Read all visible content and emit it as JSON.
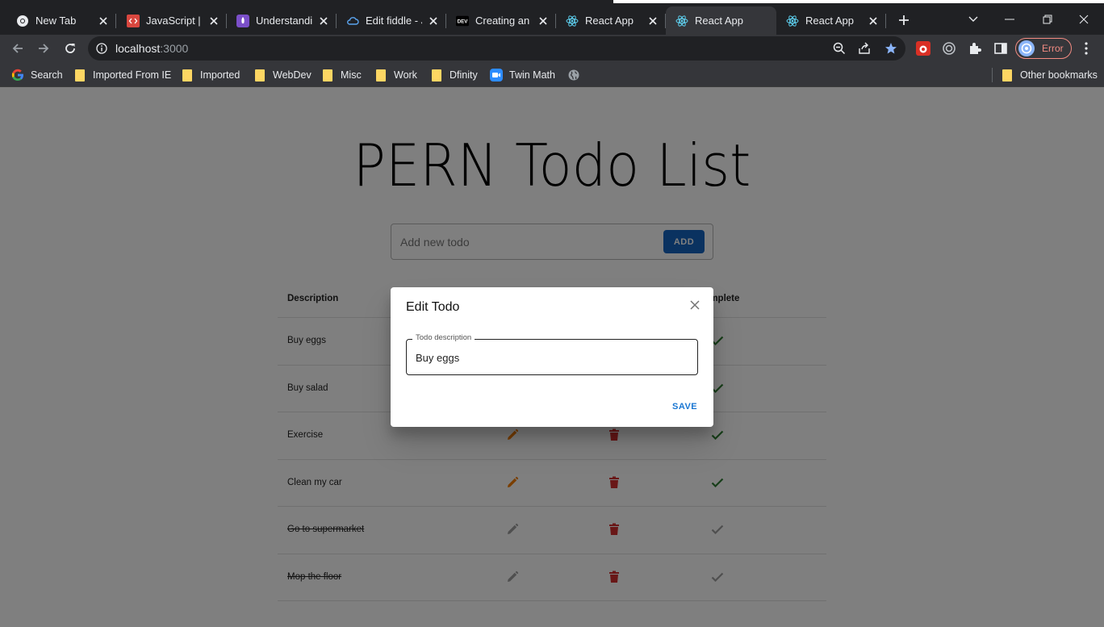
{
  "browser": {
    "tabs": [
      {
        "title": "New Tab",
        "icon": "chrome-icon",
        "active": false
      },
      {
        "title": "JavaScript | C",
        "icon": "code-icon",
        "active": false
      },
      {
        "title": "Understandin",
        "icon": "rocket-icon",
        "active": false
      },
      {
        "title": "Edit fiddle - JS",
        "icon": "cloud-icon",
        "active": false
      },
      {
        "title": "Creating an A",
        "icon": "dev-icon",
        "active": false
      },
      {
        "title": "React App",
        "icon": "react-icon",
        "active": false
      },
      {
        "title": "React App",
        "icon": "react-icon",
        "active": true
      },
      {
        "title": "React App",
        "icon": "react-icon",
        "active": false
      }
    ],
    "url_host": "localhost",
    "url_port": ":3000",
    "profile_label": "Error",
    "dev_badge": "DEV",
    "bookmarks": [
      {
        "label": "Search",
        "icon": "google-icon"
      },
      {
        "label": "Imported From IE",
        "icon": "folder-icon"
      },
      {
        "label": "Imported",
        "icon": "folder-icon"
      },
      {
        "label": "WebDev",
        "icon": "folder-icon"
      },
      {
        "label": "Misc",
        "icon": "folder-icon"
      },
      {
        "label": "Work",
        "icon": "folder-icon"
      },
      {
        "label": "Dfinity",
        "icon": "folder-icon"
      },
      {
        "label": "Twin Math",
        "icon": "zoom-icon"
      }
    ],
    "other_bookmarks": "Other bookmarks"
  },
  "app": {
    "title": "PERN Todo List",
    "input_placeholder": "Add new todo",
    "add_label": "ADD",
    "columns": {
      "description": "Description",
      "complete": "Complete"
    },
    "todos": [
      {
        "description": "Buy eggs",
        "completed": false
      },
      {
        "description": "Buy salad",
        "completed": false
      },
      {
        "description": "Exercise",
        "completed": false
      },
      {
        "description": "Clean my car",
        "completed": false
      },
      {
        "description": "Go to supermarket",
        "completed": true
      },
      {
        "description": "Mop the floor",
        "completed": true
      }
    ],
    "colors": {
      "primary": "#1976d2",
      "edit": "#f57c00",
      "delete": "#d32f2f",
      "complete": "#2e7d32",
      "disabled": "#9e9e9e"
    }
  },
  "dialog": {
    "title": "Edit Todo",
    "field_label": "Todo description",
    "field_value": "Buy eggs",
    "save_label": "SAVE"
  }
}
